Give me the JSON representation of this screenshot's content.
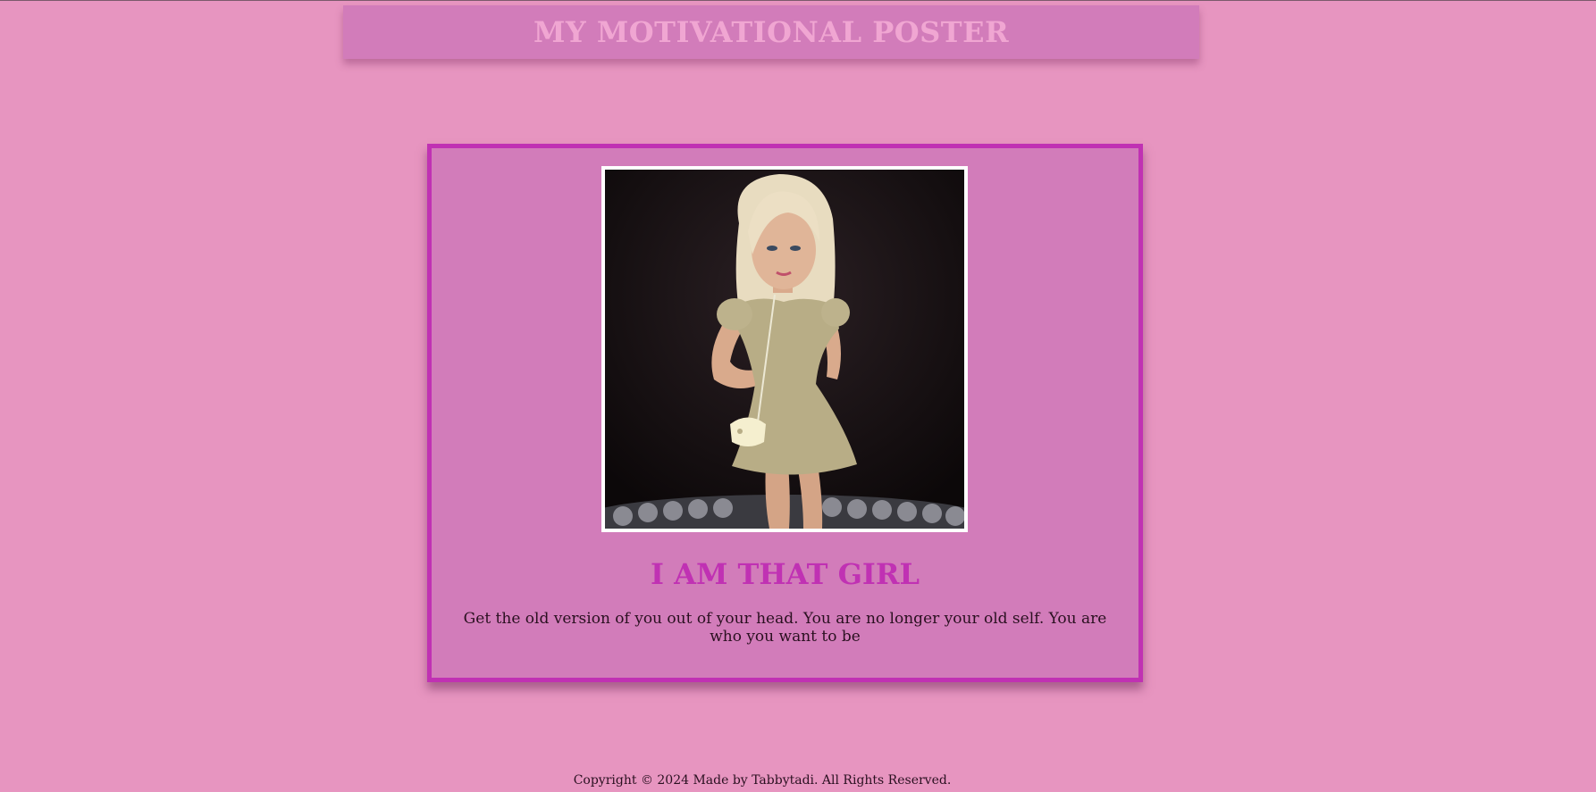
{
  "header": {
    "title": "MY MOTIVATIONAL POSTER"
  },
  "poster": {
    "image_icon": "cartoon-girl-illustration",
    "title": "I AM THAT GIRL",
    "text": "Get the old version of you out of your head. You are no longer your old self. You are who you want to be"
  },
  "footer": {
    "copyright": "Copyright © 2024 Made by Tabbytadi. All Rights Reserved."
  },
  "colors": {
    "page_background": "#e795c0",
    "panel_background": "#d27cba",
    "accent_magenta": "#c031b3",
    "header_text": "#f0a6d2"
  }
}
